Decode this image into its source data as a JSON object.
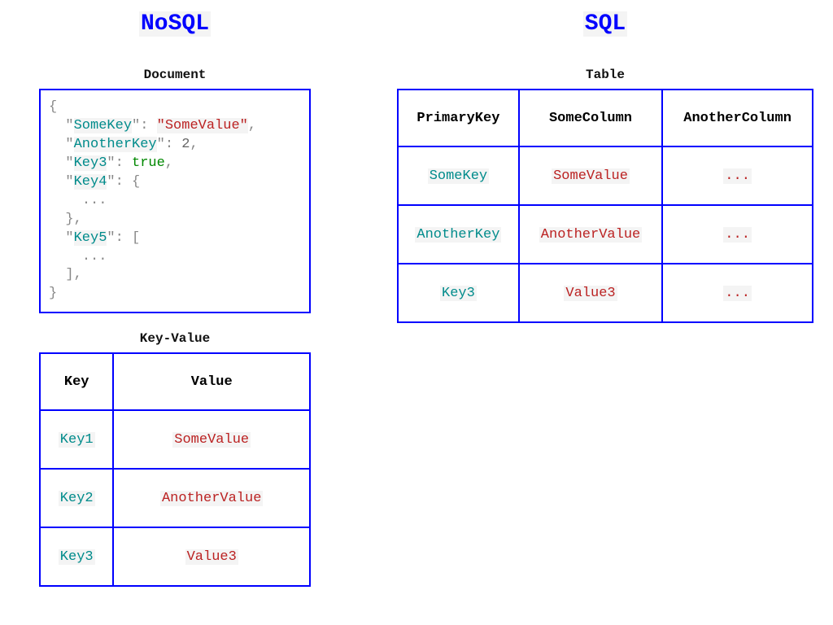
{
  "left": {
    "title": "NoSQL",
    "sections": {
      "document_label": "Document",
      "keyvalue_label": "Key-Value"
    },
    "document_code": {
      "pairs": [
        {
          "key": "SomeKey",
          "value": "\"SomeValue\"",
          "value_kind": "string"
        },
        {
          "key": "AnotherKey",
          "value": "2",
          "value_kind": "number"
        },
        {
          "key": "Key3",
          "value": "true",
          "value_kind": "bool"
        }
      ],
      "object_key": "Key4",
      "array_key": "Key5",
      "ellipsis": "..."
    },
    "kv_table": {
      "headers": [
        "Key",
        "Value"
      ],
      "rows": [
        {
          "k": "Key1",
          "v": "SomeValue"
        },
        {
          "k": "Key2",
          "v": "AnotherValue"
        },
        {
          "k": "Key3",
          "v": "Value3"
        }
      ]
    }
  },
  "right": {
    "title": "SQL",
    "sections": {
      "table_label": "Table"
    },
    "sql_table": {
      "headers": [
        "PrimaryKey",
        "SomeColumn",
        "AnotherColumn"
      ],
      "rows": [
        {
          "pk": "SomeKey",
          "c1": "SomeValue",
          "c2": "..."
        },
        {
          "pk": "AnotherKey",
          "c1": "AnotherValue",
          "c2": "..."
        },
        {
          "pk": "Key3",
          "c1": "Value3",
          "c2": "..."
        }
      ]
    }
  }
}
